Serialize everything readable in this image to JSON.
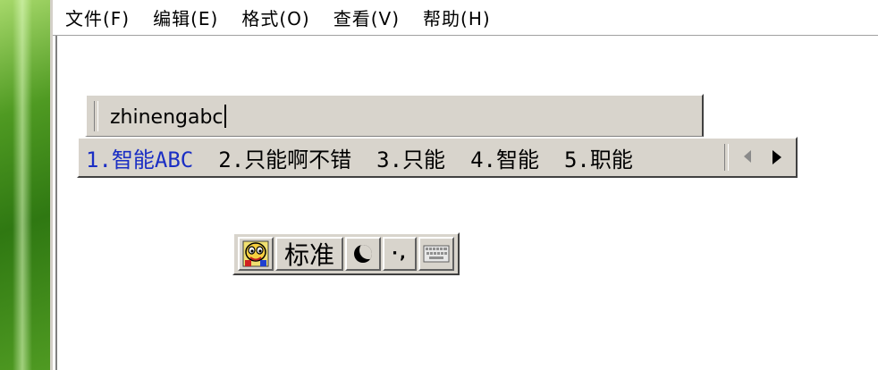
{
  "menu": {
    "items": [
      "文件(F)",
      "编辑(E)",
      "格式(O)",
      "查看(V)",
      "帮助(H)"
    ]
  },
  "composition": {
    "text": "zhinengabc"
  },
  "candidates": {
    "items": [
      "1.智能ABC",
      "2.只能啊不错",
      "3.只能",
      "4.智能",
      "5.职能"
    ],
    "selected_index": 0,
    "selected_color": "#1a2ec4"
  },
  "ime_status": {
    "mode_label": "标准",
    "logo_icon": "ime-logo-icon",
    "shape_icon": "half-moon-icon",
    "punct_glyph": "·,",
    "keyboard_icon": "soft-keyboard-icon"
  },
  "colors": {
    "face": "#d8d4cc",
    "desktop": "#2f7812"
  }
}
